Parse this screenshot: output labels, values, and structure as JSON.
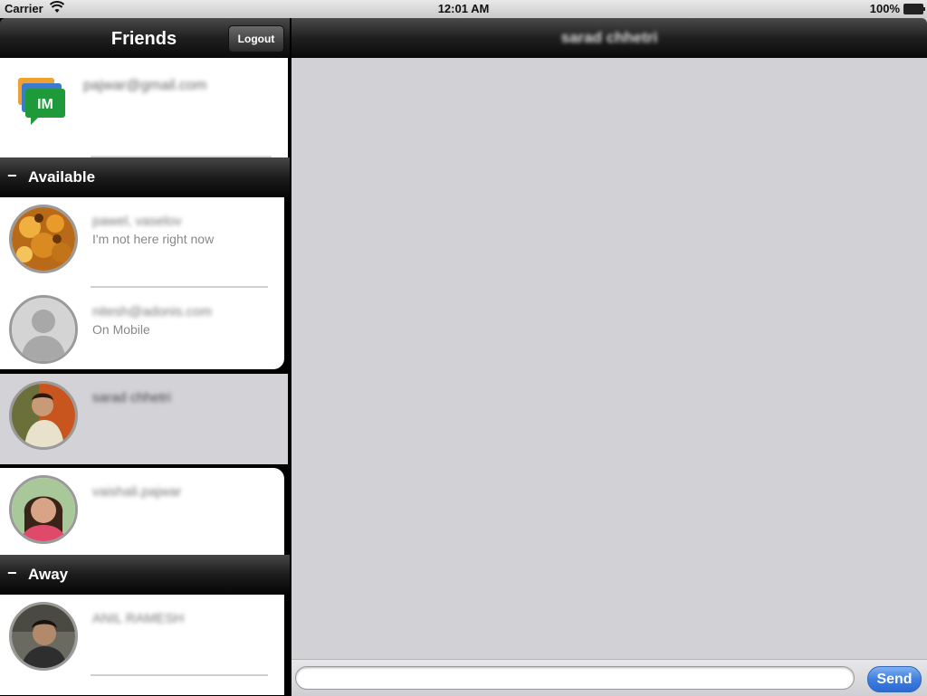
{
  "statusbar": {
    "carrier": "Carrier",
    "time": "12:01 AM",
    "battery": "100%"
  },
  "left_nav": {
    "title": "Friends",
    "logout_label": "Logout"
  },
  "account": {
    "logo_text": "IM",
    "email": "pajwar@gmail.com"
  },
  "sections": {
    "available": "Available",
    "away": "Away",
    "collapse_symbol": "−"
  },
  "friends": {
    "f1": {
      "name": "pawel, vaselov",
      "status": "I'm not here right now"
    },
    "f2": {
      "name": "nitesh@adonis.com",
      "status": "On  Mobile"
    },
    "f3": {
      "name": "sarad chhetri",
      "status": ""
    },
    "f4": {
      "name": "vaishali.pajwar",
      "status": ""
    },
    "f5": {
      "name": "ANIL RAMESH",
      "status": ""
    }
  },
  "chat": {
    "title": "sarad chhetri",
    "message_placeholder": "",
    "send_label": "Send"
  },
  "colors": {
    "accent": "#3f7fe0",
    "selected_row": "#d3d3d7"
  }
}
